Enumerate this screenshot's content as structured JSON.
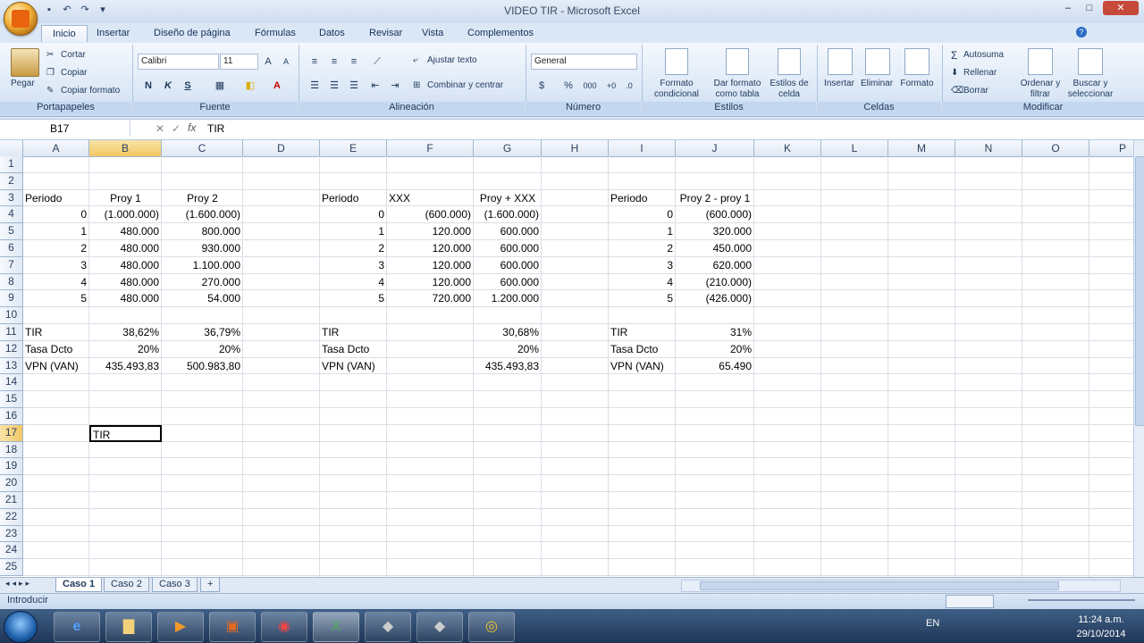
{
  "window": {
    "title": "VIDEO TIR - Microsoft Excel"
  },
  "tabs": [
    "Inicio",
    "Insertar",
    "Diseño de página",
    "Fórmulas",
    "Datos",
    "Revisar",
    "Vista",
    "Complementos"
  ],
  "ribbon": {
    "portapapeles": {
      "label": "Portapapeles",
      "paste": "Pegar",
      "cut": "Cortar",
      "copy": "Copiar",
      "format_painter": "Copiar formato"
    },
    "fuente": {
      "label": "Fuente",
      "font": "Calibri",
      "size": "11",
      "bold": "N",
      "italic": "K",
      "underline": "S"
    },
    "alineacion": {
      "label": "Alineación",
      "wrap": "Ajustar texto",
      "merge": "Combinar y centrar"
    },
    "numero": {
      "label": "Número",
      "format": "General",
      "currency": "$",
      "percent": "%",
      "thousands": "000"
    },
    "estilos": {
      "label": "Estilos",
      "conditional": "Formato condicional",
      "as_table": "Dar formato como tabla",
      "cell_styles": "Estilos de celda"
    },
    "celdas": {
      "label": "Celdas",
      "insert": "Insertar",
      "delete": "Eliminar",
      "format": "Formato"
    },
    "modificar": {
      "label": "Modificar",
      "autosum": "Autosuma",
      "fill": "Rellenar",
      "clear": "Borrar",
      "sort": "Ordenar y filtrar",
      "find": "Buscar y seleccionar"
    }
  },
  "formula_bar": {
    "name_box": "B17",
    "fx": "fx",
    "content": "TIR"
  },
  "columns": [
    "A",
    "B",
    "C",
    "D",
    "E",
    "F",
    "G",
    "H",
    "I",
    "J",
    "K",
    "L",
    "M",
    "N",
    "O",
    "P"
  ],
  "rows": [
    "1",
    "2",
    "3",
    "4",
    "5",
    "6",
    "7",
    "8",
    "9",
    "10",
    "11",
    "12",
    "13",
    "14",
    "15",
    "16",
    "17",
    "18",
    "19",
    "20",
    "21",
    "22",
    "23",
    "24",
    "25"
  ],
  "cells": {
    "A3": "Periodo",
    "B3": "Proy 1",
    "C3": "Proy 2",
    "A4": "0",
    "B4": "(1.000.000)",
    "C4": "(1.600.000)",
    "A5": "1",
    "B5": "480.000",
    "C5": "800.000",
    "A6": "2",
    "B6": "480.000",
    "C6": "930.000",
    "A7": "3",
    "B7": "480.000",
    "C7": "1.100.000",
    "A8": "4",
    "B8": "480.000",
    "C8": "270.000",
    "A9": "5",
    "B9": "480.000",
    "C9": "54.000",
    "A11": "TIR",
    "B11": "38,62%",
    "C11": "36,79%",
    "A12": "Tasa Dcto",
    "B12": "20%",
    "C12": "20%",
    "A13": "VPN (VAN)",
    "B13": "435.493,83",
    "C13": "500.983,80",
    "E3": "Periodo",
    "F3": "XXX",
    "G3": "Proy + XXX",
    "E4": "0",
    "F4": "(600.000)",
    "G4": "(1.600.000)",
    "E5": "1",
    "F5": "120.000",
    "G5": "600.000",
    "E6": "2",
    "F6": "120.000",
    "G6": "600.000",
    "E7": "3",
    "F7": "120.000",
    "G7": "600.000",
    "E8": "4",
    "F8": "120.000",
    "G8": "600.000",
    "E9": "5",
    "F9": "720.000",
    "G9": "1.200.000",
    "E11": "TIR",
    "G11": "30,68%",
    "E12": "Tasa Dcto",
    "G12": "20%",
    "E13": "VPN (VAN)",
    "G13": "435.493,83",
    "I3": "Periodo",
    "J3": "Proy 2 - proy 1",
    "I4": "0",
    "J4": "(600.000)",
    "I5": "1",
    "J5": "320.000",
    "I6": "2",
    "J6": "450.000",
    "I7": "3",
    "J7": "620.000",
    "I8": "4",
    "J8": "(210.000)",
    "I9": "5",
    "J9": "(426.000)",
    "I11": "TIR",
    "J11": "31%",
    "I12": "Tasa Dcto",
    "J12": "20%",
    "I13": "VPN (VAN)",
    "J13": "65.490",
    "B17": "TIR"
  },
  "sheets": [
    "Caso 1",
    "Caso 2",
    "Caso 3"
  ],
  "status": {
    "mode": "Introducir"
  },
  "taskbar": {
    "lang": "EN",
    "time": "11:24 a.m.",
    "date": "29/10/2014"
  }
}
